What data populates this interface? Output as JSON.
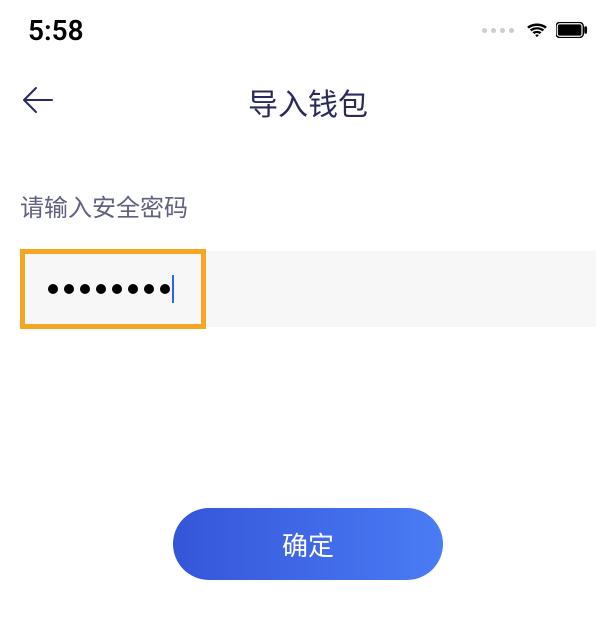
{
  "statusBar": {
    "time": "5:58"
  },
  "header": {
    "title": "导入钱包"
  },
  "form": {
    "passwordLabel": "请输入安全密码",
    "passwordDotCount": 8
  },
  "actions": {
    "submitLabel": "确定"
  }
}
